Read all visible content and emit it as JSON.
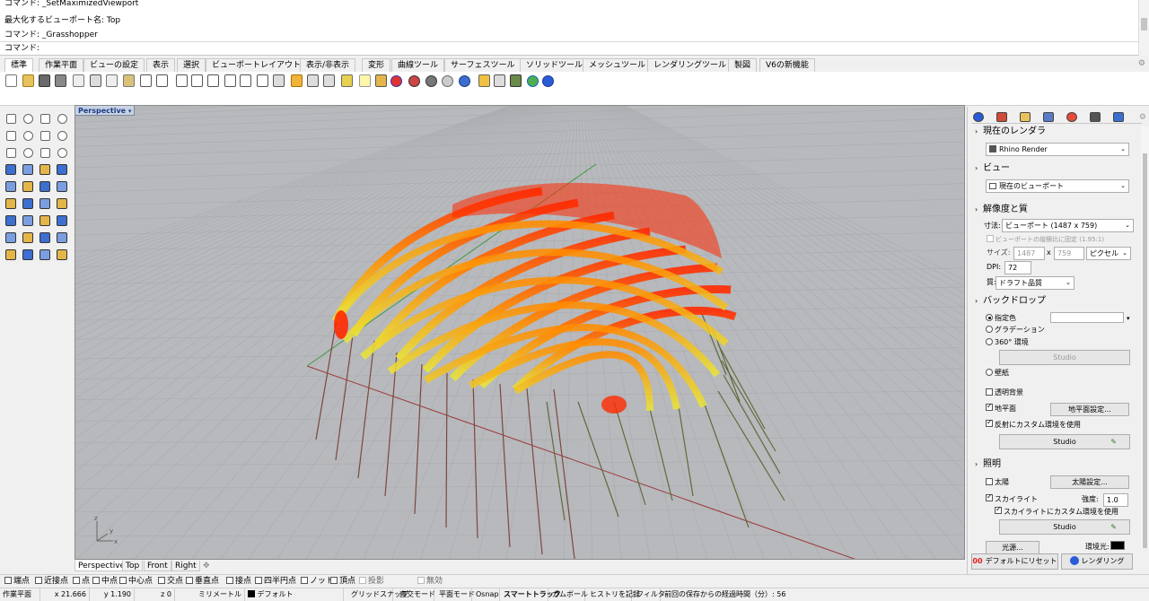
{
  "command_history": {
    "lines": [
      "コマンド: _SetMaximizedViewport",
      "最大化するビューポート名: Top",
      "コマンド: _Grasshopper"
    ],
    "prompt": "コマンド:"
  },
  "tabs": [
    "標準",
    "作業平面",
    "ビューの設定",
    "表示",
    "選択",
    "ビューポートレイアウト",
    "表示/非表示",
    "変形",
    "曲線ツール",
    "サーフェスツール",
    "ソリッドツール",
    "メッシュツール",
    "レンダリングツール",
    "製図",
    "V6の新機能"
  ],
  "active_tab": "標準",
  "viewport": {
    "label": "Perspective",
    "arrow": "▾",
    "axis_z": "z",
    "axis_y": "y",
    "axis_x": "x"
  },
  "viewport_tabs": [
    "Perspective",
    "Top",
    "Front",
    "Right"
  ],
  "viewport_add": "✥",
  "osnaps": [
    {
      "label": "端点",
      "checked": false
    },
    {
      "label": "近接点",
      "checked": false
    },
    {
      "label": "点",
      "checked": false
    },
    {
      "label": "中点",
      "checked": false
    },
    {
      "label": "中心点",
      "checked": false
    },
    {
      "label": "交点",
      "checked": false
    },
    {
      "label": "垂直点",
      "checked": false
    },
    {
      "label": "接点",
      "checked": false
    },
    {
      "label": "四半円点",
      "checked": false
    },
    {
      "label": "ノット",
      "checked": false
    },
    {
      "label": "頂点",
      "checked": false
    },
    {
      "label": "投影",
      "checked": false
    },
    {
      "label": "無効",
      "checked": false
    }
  ],
  "status": {
    "cplane": "作業平面",
    "x": "x 21.666",
    "y": "y 1.190",
    "z": "z 0",
    "units": "ミリメートル",
    "layer": "デフォルト",
    "grid_snap": "グリッドスナップ",
    "ortho": "直交モード",
    "planar": "平面モード",
    "osnap": "Osnap",
    "smarttrack": "スマートトラック",
    "gumball": "ガムボール",
    "history": "ヒストリを記録",
    "filter": "フィルタ",
    "elapsed": "前回の保存からの経過時間（分）: 56"
  },
  "render_panel": {
    "current_renderer_header": "現在のレンダラ",
    "renderer": "Rhino Render",
    "view_header": "ビュー",
    "view": "現在のビューポート",
    "resolution_header": "解像度と質",
    "size_label": "寸法:",
    "size_value": "ビューポート (1487 x 759)",
    "lock_aspect": "ビューポートの縦横比に固定 (1.95:1)",
    "size2_label": "サイズ:",
    "width": "1487",
    "times": "x",
    "height": "759",
    "pixel_unit": "ピクセル",
    "dpi_label": "DPI:",
    "dpi": "72",
    "quality_label": "質:",
    "quality": "ドラフト品質",
    "backdrop_header": "バックドロップ",
    "solid_color": "指定色",
    "gradient": "グラデーション",
    "env360": "360° 環境",
    "studio_dim": "Studio",
    "wallpaper": "壁紙",
    "transparent_bg": "透明背景",
    "ground_plane": "地平面",
    "ground_settings": "地平面設定...",
    "custom_reflect": "反射にカスタム環境を使用",
    "studio1": "Studio",
    "lighting_header": "照明",
    "sun": "太陽",
    "sun_settings": "太陽設定...",
    "skylight": "スカイライト",
    "intensity_label": "強度:",
    "intensity": "1.0",
    "sky_custom": "スカイライトにカスタム環境を使用",
    "studio2": "Studio",
    "light_sources": "光源...",
    "ambient": "環境光:",
    "reset_button": "デフォルトにリセット",
    "render_button": "レンダリング"
  },
  "colors": {
    "viewport_bg": "#b7b9bd",
    "grid_line": "#a9abae",
    "axis_x": "#9c3a3a",
    "axis_y": "#3f9a3f",
    "arch_hot": "#ff2a00",
    "arch_mid": "#ff8c00",
    "arch_cool": "#e8e43a"
  }
}
